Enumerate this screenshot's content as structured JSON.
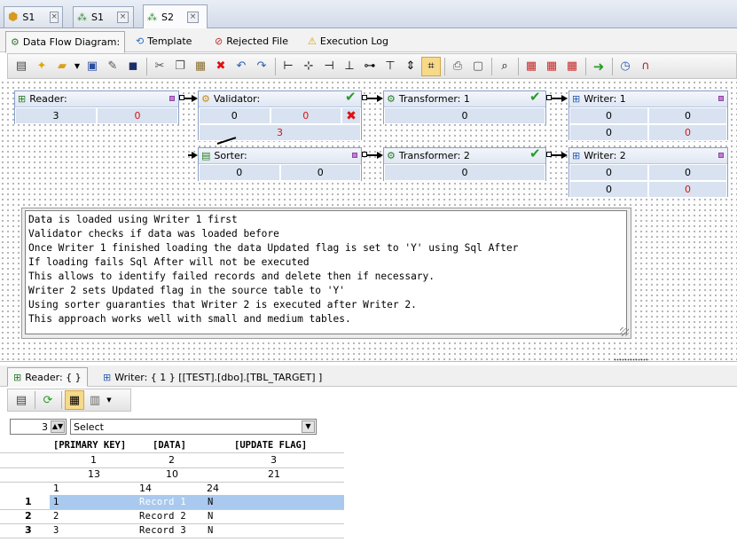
{
  "doc_tabs": [
    {
      "label": "S1",
      "icon": "cube-icon"
    },
    {
      "label": "S1",
      "icon": "tree-icon"
    },
    {
      "label": "S2",
      "icon": "tree-icon",
      "active": true
    }
  ],
  "sub_tabs": [
    {
      "label": "Data Flow Diagram:",
      "active": true
    },
    {
      "label": "Template"
    },
    {
      "label": "Rejected File"
    },
    {
      "label": "Execution Log"
    }
  ],
  "nodes": {
    "reader": {
      "title": "Reader:",
      "values": [
        "3",
        "0"
      ]
    },
    "validator": {
      "title": "Validator:",
      "values": [
        "0",
        "0",
        "3"
      ]
    },
    "transformer1": {
      "title": "Transformer: 1",
      "values": [
        "0"
      ]
    },
    "writer1": {
      "title": "Writer: 1",
      "values": [
        "0",
        "0",
        "0",
        "0"
      ]
    },
    "sorter": {
      "title": "Sorter:",
      "values": [
        "0",
        "0"
      ]
    },
    "transformer2": {
      "title": "Transformer: 2",
      "values": [
        "0"
      ]
    },
    "writer2": {
      "title": "Writer: 2",
      "values": [
        "0",
        "0",
        "0",
        "0"
      ]
    }
  },
  "notes": [
    "Data is loaded using Writer 1 first",
    "Validator checks if data was loaded before",
    "Once Writer 1 finished loading the data Updated flag is set to 'Y' using Sql After",
    "If loading fails Sql After will not be executed",
    "This allows to identify failed records and delete then if necessary.",
    "Writer 2 sets Updated flag in the source table to 'Y'",
    "Using sorter guaranties that Writer 2 is executed after Writer 2.",
    "This approach works well with small and medium tables."
  ],
  "bottom_tabs": [
    {
      "label": "Reader: { }",
      "active": true
    },
    {
      "label": "Writer: { 1 } [[TEST].[dbo].[TBL_TARGET] ]"
    }
  ],
  "row_count": "3",
  "select": {
    "value": "Select"
  },
  "grid": {
    "headers": [
      "[PRIMARY KEY]",
      "[DATA]",
      "[UPDATE FLAG]"
    ],
    "col_index": [
      "1",
      "2",
      "3"
    ],
    "col_width": [
      "13",
      "10",
      "21"
    ],
    "col_pos": [
      "1",
      "14",
      "24"
    ],
    "rows": [
      {
        "num": "1",
        "key": "1",
        "data": "Record 1",
        "flag": "N",
        "selected": true
      },
      {
        "num": "2",
        "key": "2",
        "data": "Record 2",
        "flag": "N"
      },
      {
        "num": "3",
        "key": "3",
        "data": "Record 3",
        "flag": "N"
      }
    ]
  }
}
